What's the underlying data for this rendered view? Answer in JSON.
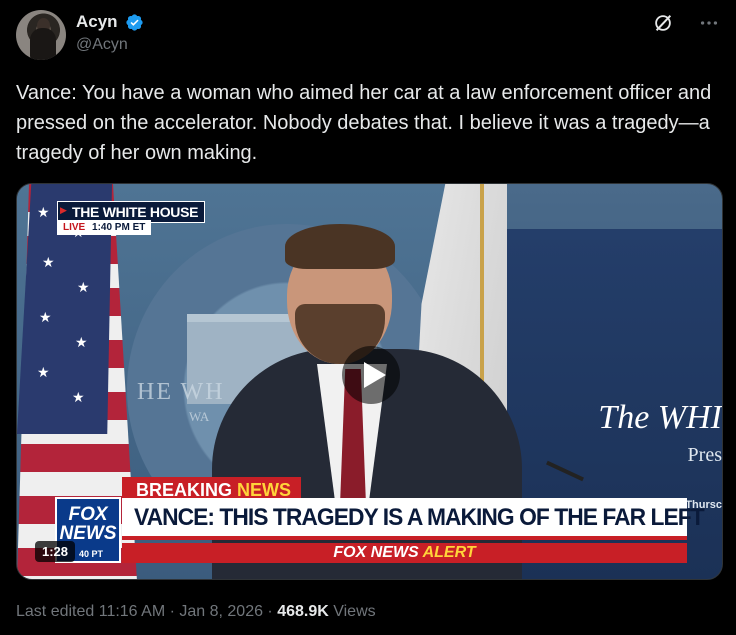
{
  "author": {
    "display_name": "Acyn",
    "handle": "@Acyn",
    "verified": true
  },
  "icons": {
    "verified": "verified-badge-icon",
    "grok": "grok-slash-icon",
    "more": "more-horizontal-icon"
  },
  "tweet": {
    "text": "Vance: You have a woman who aimed her car at a law enforcement officer and pressed on the accelerator. Nobody debates that. I believe it was a tragedy—a tragedy of her own making."
  },
  "video": {
    "duration": "1:28",
    "bug_title": "THE WHITE HOUSE",
    "live_label": "LIVE",
    "live_time": "1:40 PM ET",
    "breaking_label": "BREAKING",
    "breaking_news": "NEWS",
    "headline": "VANCE: THIS TRAGEDY IS A MAKING OF THE FAR LEFT",
    "alert_brand": "FOX NEWS",
    "alert_word": "ALERT",
    "fox_logo": "FOX NEWS",
    "fox_time": "40 PT",
    "bg_text_left": "HE WH",
    "bg_text_left_sub": "WA",
    "bg_text_right": "The WHI",
    "bg_text_right_sub": "Pres",
    "bg_text_right_day": "Thursc"
  },
  "meta": {
    "edited": "Last edited 11:16 AM · Jan 8, 2026 · ",
    "views_count": "468.9K",
    "views_label": " Views"
  },
  "colors": {
    "background": "#000000",
    "text": "#e7e9ea",
    "secondary": "#71767b",
    "verified": "#1d9bf0",
    "fox_red": "#c81f26"
  }
}
